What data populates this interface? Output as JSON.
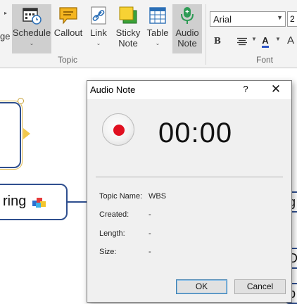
{
  "ribbon": {
    "left_partial_label": "ge",
    "buttons": [
      {
        "label": "Schedule",
        "icon": "schedule-calendar-icon",
        "has_dropdown": true,
        "pressed": true
      },
      {
        "label": "Callout",
        "icon": "callout-bubble-icon",
        "has_dropdown": false,
        "pressed": false
      },
      {
        "label": "Link",
        "icon": "link-icon",
        "has_dropdown": true,
        "pressed": false
      },
      {
        "label_line1": "Sticky",
        "label_line2": "Note",
        "icon": "sticky-note-icon",
        "has_dropdown": false,
        "pressed": false
      },
      {
        "label": "Table",
        "icon": "table-grid-icon",
        "has_dropdown": true,
        "pressed": false
      },
      {
        "label_line1": "Audio",
        "label_line2": "Note",
        "icon": "microphone-icon",
        "has_dropdown": false,
        "pressed": true
      }
    ],
    "groups": {
      "topic": "Topic",
      "font": "Font"
    },
    "font": {
      "family": "Arial",
      "size_partial": "2"
    },
    "format_buttons": {
      "bold": "B",
      "font_color": "A",
      "text_size": "A"
    }
  },
  "canvas": {
    "main_node_text": "ring",
    "right_node_texts": [
      "g",
      "D",
      "p"
    ],
    "accent_colors": {
      "node_border": "#2f4f8f",
      "selection": "#f2c84b"
    }
  },
  "dialog": {
    "title": "Audio Note",
    "help": "?",
    "close": "✕",
    "timer": "00:00",
    "record_color": "#e01020",
    "fields": [
      {
        "label": "Topic Name:",
        "value": "WBS"
      },
      {
        "label": "Created:",
        "value": "-"
      },
      {
        "label": "Length:",
        "value": "-"
      },
      {
        "label": "Size:",
        "value": "-"
      }
    ],
    "ok": "OK",
    "cancel": "Cancel"
  }
}
